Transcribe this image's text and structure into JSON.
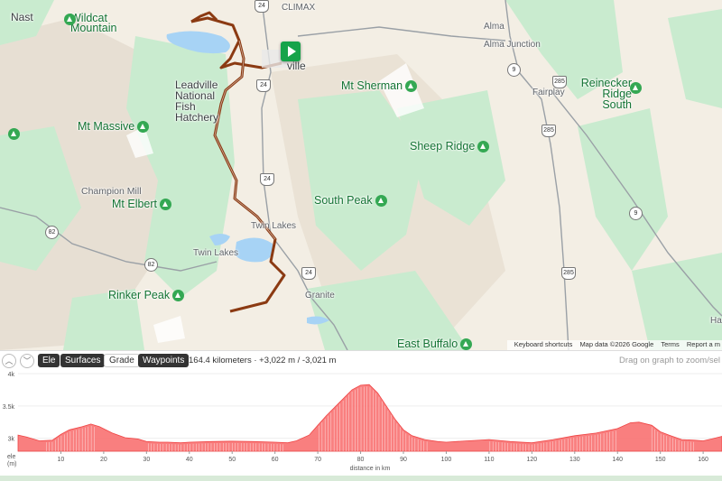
{
  "map": {
    "labels": {
      "nast": "Nast",
      "wildcat": "Wildcat Mountain",
      "climax": "CLIMAX",
      "alma": "Alma",
      "alma_junction": "Alma Junction",
      "leadville": "ville",
      "leadville_hatchery": "Leadville National Fish Hatchery",
      "mt_sherman": "Mt Sherman",
      "fairplay": "Fairplay",
      "reinecker": "Reinecker Ridge South",
      "mt_massive": "Mt Massive",
      "sheep_ridge": "Sheep Ridge",
      "champion_mill": "Champion Mill",
      "mt_elbert": "Mt Elbert",
      "south_peak": "South Peak",
      "twin_lakes_town": "Twin Lakes",
      "twin_lakes_lake": "Twin Lakes",
      "rinker_peak": "Rinker Peak",
      "granite": "Granite",
      "east_buffalo": "East Buffalo",
      "edge_h": "Ha"
    },
    "shields": [
      "24",
      "9",
      "285",
      "285",
      "24",
      "82",
      "82",
      "24",
      "9",
      "285",
      "24"
    ],
    "attribution": {
      "shortcuts": "Keyboard shortcuts",
      "mapdata": "Map data ©2026 Google",
      "terms": "Terms",
      "report": "Report a m"
    },
    "colors": {
      "route": "#8b3a12",
      "start": "#16a34a",
      "forest": "#c9ebcf",
      "water": "#a7d3f5"
    }
  },
  "toolbar": {
    "collapse_up": "︿",
    "collapse_down": "﹀",
    "buttons": [
      {
        "label": "Ele",
        "active": true
      },
      {
        "label": "Surfaces",
        "active": true
      },
      {
        "label": "Grade",
        "active": false
      },
      {
        "label": "Waypoints",
        "active": true
      }
    ],
    "stats": "164.4 kilometers · +3,022 m / -3,021 m",
    "hint": "Drag on graph to zoom/sel"
  },
  "chart_data": {
    "type": "area",
    "title": "",
    "xlabel": "distance in km",
    "ylabel": "ele (m)",
    "ylabel_lines": [
      "ele",
      "(m)"
    ],
    "y_ticks": [
      {
        "v": 3000,
        "label": "3k"
      },
      {
        "v": 3500,
        "label": "3.5k"
      },
      {
        "v": 4000,
        "label": "4k"
      }
    ],
    "x_ticks": [
      10,
      20,
      30,
      40,
      50,
      60,
      70,
      80,
      90,
      100,
      110,
      120,
      130,
      140,
      150,
      160
    ],
    "xlim": [
      0,
      164.4
    ],
    "ylim": [
      2800,
      4000
    ],
    "color": "#f87171",
    "x": [
      0,
      2,
      5,
      8,
      10,
      12,
      15,
      17,
      19,
      22,
      25,
      28,
      30,
      33,
      35,
      38,
      40,
      45,
      50,
      55,
      60,
      63,
      65,
      68,
      70,
      72,
      75,
      78,
      80,
      82,
      84,
      86,
      88,
      90,
      92,
      95,
      98,
      100,
      105,
      110,
      115,
      120,
      125,
      130,
      135,
      140,
      143,
      145,
      148,
      150,
      152,
      155,
      158,
      160,
      162,
      164.4
    ],
    "y": [
      3050,
      3020,
      2960,
      2970,
      3060,
      3130,
      3180,
      3220,
      3180,
      3080,
      3010,
      2990,
      2950,
      2940,
      2940,
      2930,
      2940,
      2950,
      2955,
      2950,
      2940,
      2930,
      2960,
      3050,
      3200,
      3350,
      3550,
      3750,
      3820,
      3830,
      3700,
      3500,
      3300,
      3130,
      3040,
      2980,
      2950,
      2940,
      2960,
      2980,
      2950,
      2930,
      2980,
      3040,
      3080,
      3150,
      3240,
      3250,
      3200,
      3100,
      3050,
      2980,
      2970,
      2960,
      2990,
      3030
    ]
  }
}
